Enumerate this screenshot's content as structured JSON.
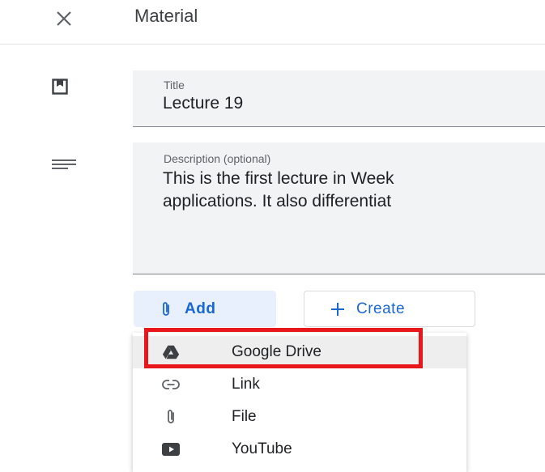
{
  "header": {
    "close_icon": "close-icon",
    "title": "Material"
  },
  "form": {
    "title": {
      "icon": "bookmark-icon",
      "label": "Title",
      "value": "Lecture 19"
    },
    "description": {
      "icon": "notes-icon",
      "label": "Description (optional)",
      "value": "This is the first lecture in Week\napplications. It also differentiat"
    }
  },
  "actions": {
    "add_label": "Add",
    "add_icon": "paperclip-icon",
    "create_label": "Create",
    "create_icon": "plus-icon"
  },
  "add_menu": {
    "items": [
      {
        "label": "Google Drive",
        "icon": "google-drive-icon",
        "hovered": true
      },
      {
        "label": "Link",
        "icon": "link-icon"
      },
      {
        "label": "File",
        "icon": "paperclip-icon"
      },
      {
        "label": "YouTube",
        "icon": "youtube-icon"
      }
    ]
  },
  "colors": {
    "accent": "#1967d2",
    "add_button_bg": "#e8f0fe",
    "field_bg": "#f1f3f4",
    "highlight_box": "#e8171c"
  }
}
